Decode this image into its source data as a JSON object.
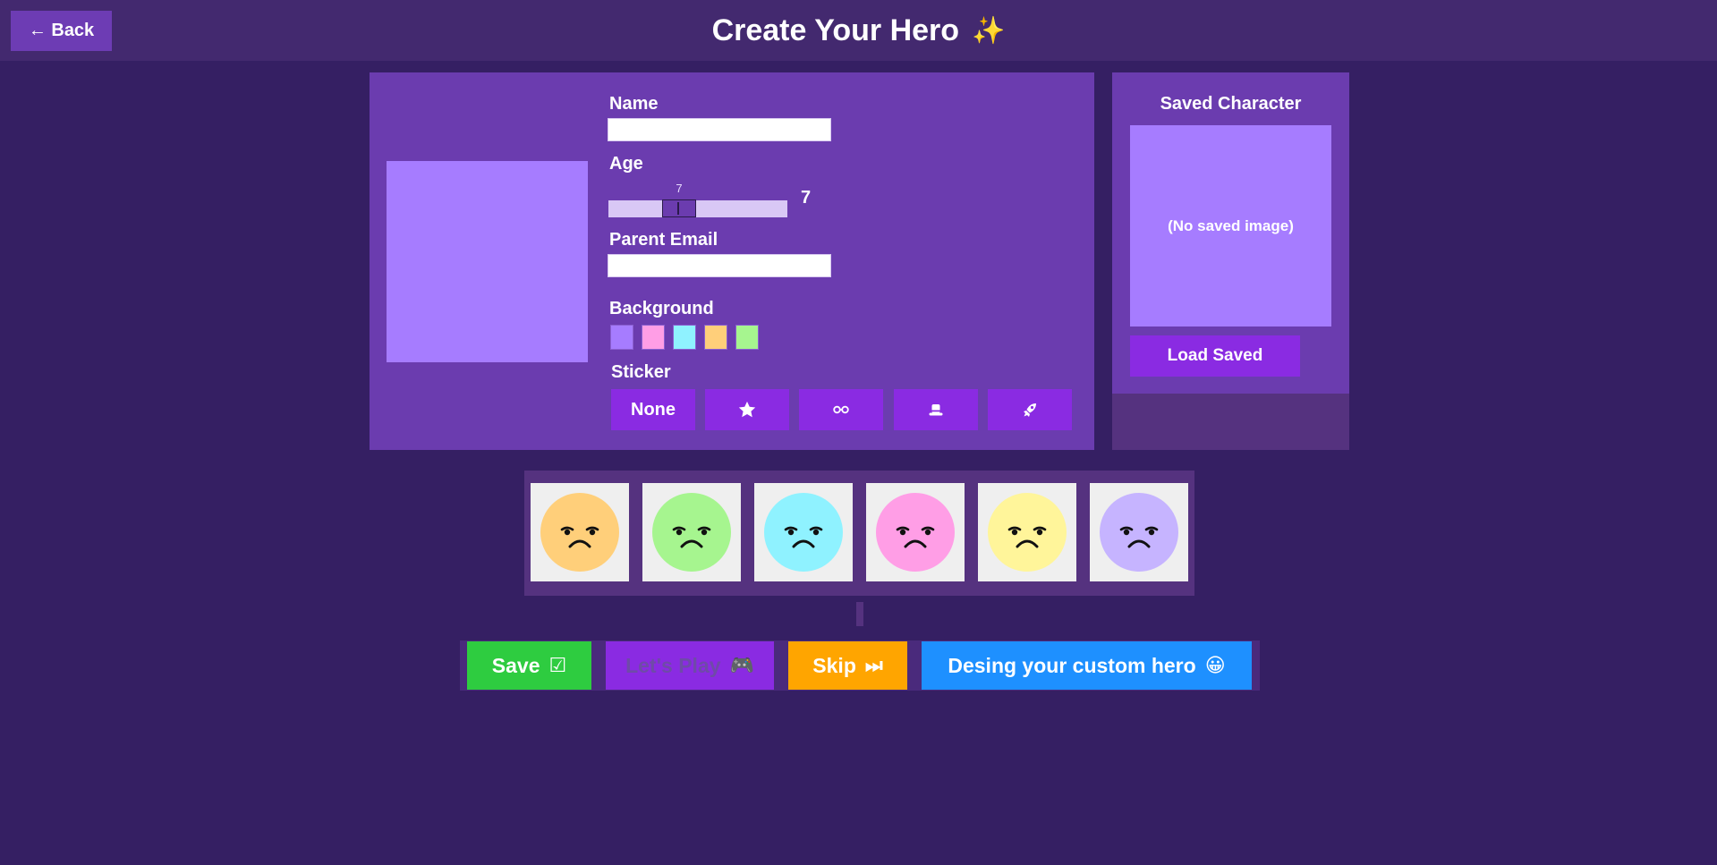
{
  "header": {
    "back_label": "← Back",
    "title": "Create Your Hero",
    "title_icon": "✨"
  },
  "editor": {
    "name": {
      "label": "Name",
      "value": ""
    },
    "age": {
      "label": "Age",
      "value": 7,
      "min": 3,
      "max": 16,
      "tip": "7",
      "display": "7"
    },
    "email": {
      "label": "Parent Email",
      "value": ""
    },
    "background": {
      "label": "Background",
      "swatches": [
        "#a67cff",
        "#ff9ee6",
        "#8ff2ff",
        "#ffcf7a",
        "#a6f58f"
      ]
    },
    "sticker": {
      "label": "Sticker",
      "options": [
        {
          "label": "None",
          "icon": ""
        },
        {
          "label": "",
          "icon": "star-icon"
        },
        {
          "label": "",
          "icon": "glasses-icon"
        },
        {
          "label": "",
          "icon": "hat-icon"
        },
        {
          "label": "",
          "icon": "rocket-icon"
        }
      ]
    }
  },
  "saved": {
    "title": "Saved Character",
    "empty_text": "(No saved image)",
    "load_label": "Load Saved"
  },
  "faces": [
    {
      "color": "#ffcf7a",
      "mood": "sad"
    },
    {
      "color": "#a6f58f",
      "mood": "sad"
    },
    {
      "color": "#8ff2ff",
      "mood": "sad"
    },
    {
      "color": "#ff9ee6",
      "mood": "sad"
    },
    {
      "color": "#fff59a",
      "mood": "sad"
    },
    {
      "color": "#c6b4ff",
      "mood": "sad"
    }
  ],
  "actions": {
    "save": {
      "label": "Save",
      "icon": "☑",
      "color": "#2ecc40"
    },
    "play": {
      "label": "Let's Play",
      "icon": "🎮",
      "color": "#8a2be2",
      "text_color": "#6f4aa8"
    },
    "skip": {
      "label": "Skip",
      "icon": "⏭",
      "color": "#ffa500"
    },
    "custom": {
      "label": "Desing your custom hero",
      "icon": "😀",
      "color": "#1e90ff"
    }
  }
}
